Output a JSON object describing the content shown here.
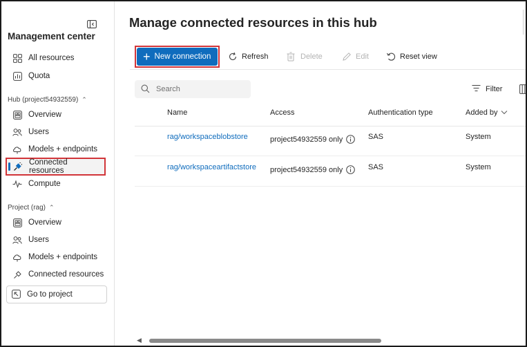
{
  "sidebar": {
    "title": "Management center",
    "top_items": [
      {
        "label": "All resources",
        "icon": "grid-icon"
      },
      {
        "label": "Quota",
        "icon": "quota-icon"
      }
    ],
    "hub_section": "Hub (project54932559)",
    "hub_items": [
      {
        "label": "Overview",
        "icon": "overview-icon"
      },
      {
        "label": "Users",
        "icon": "users-icon"
      },
      {
        "label": "Models + endpoints",
        "icon": "cloud-models-icon"
      },
      {
        "label": "Connected resources",
        "icon": "plug-icon",
        "selected": true
      },
      {
        "label": "Compute",
        "icon": "pulse-icon"
      }
    ],
    "project_section": "Project (rag)",
    "project_items": [
      {
        "label": "Overview",
        "icon": "overview-icon"
      },
      {
        "label": "Users",
        "icon": "users-icon"
      },
      {
        "label": "Models + endpoints",
        "icon": "cloud-models-icon"
      },
      {
        "label": "Connected resources",
        "icon": "plug-icon"
      }
    ],
    "go_to_project": "Go to project"
  },
  "main": {
    "title": "Manage connected resources in this hub",
    "toolbar": {
      "new_connection": "New connection",
      "refresh": "Refresh",
      "delete": "Delete",
      "edit": "Edit",
      "reset_view": "Reset view"
    },
    "search_placeholder": "Search",
    "filter": "Filter",
    "table": {
      "columns": [
        "Name",
        "Access",
        "Authentication type",
        "Added by"
      ],
      "rows": [
        {
          "name": "rag/workspaceblobstore",
          "access": "project54932559 only",
          "auth": "SAS",
          "added_by": "System"
        },
        {
          "name": "rag/workspaceartifactstore",
          "access": "project54932559 only",
          "auth": "SAS",
          "added_by": "System"
        }
      ]
    }
  },
  "colors": {
    "accent": "#0f6cbd",
    "highlight": "#d13438"
  }
}
